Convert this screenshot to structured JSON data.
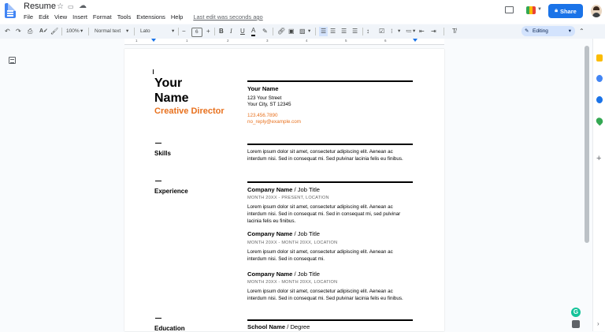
{
  "doc": {
    "title": "Resume",
    "last_edit": "Last edit was seconds ago",
    "share": "Share",
    "menus": [
      "File",
      "Edit",
      "View",
      "Insert",
      "Format",
      "Tools",
      "Extensions",
      "Help"
    ]
  },
  "toolbar": {
    "zoom": "100%",
    "style": "Normal text",
    "font": "Lato",
    "size": "6",
    "mode": "Editing"
  },
  "ruler": [
    "1",
    "1",
    "2",
    "3",
    "4",
    "5",
    "6"
  ],
  "resume": {
    "name_line1": "Your",
    "name_line2": "Name",
    "role": "Creative Director",
    "contact": {
      "name": "Your Name",
      "street": "123 Your Street",
      "city": "Your City, ST 12345",
      "phone": "123.456.7890",
      "email": "no_reply@example.com"
    },
    "skills_label": "Skills",
    "skills_text": [
      "Lorem ipsum dolor sit amet, consectetur adipiscing elit. Aenean ac",
      "interdum nisi. Sed in consequat mi. Sed pulvinar lacinia felis eu finibus."
    ],
    "experience_label": "Experience",
    "jobs": [
      {
        "company": "Company Name",
        "title": " / Job Title",
        "dates": "MONTH 20XX - PRESENT,  LOCATION",
        "lines": [
          "Lorem ipsum dolor sit amet, consectetur adipiscing elit. Aenean ac",
          "interdum nisi. Sed in consequat mi. Sed in consequat mi, sed pulvinar",
          "lacinia felis eu finibus."
        ]
      },
      {
        "company": "Company Name",
        "title": " / Job Title",
        "dates": "MONTH 20XX - MONTH 20XX,  LOCATION",
        "lines": [
          "Lorem ipsum dolor sit amet, consectetur adipiscing elit. Aenean ac",
          "interdum nisi. Sed in consequat mi."
        ]
      },
      {
        "company": "Company Name",
        "title": " / Job Title",
        "dates": "MONTH 20XX - MONTH 20XX,  LOCATION",
        "lines": [
          "Lorem ipsum dolor sit amet, consectetur adipiscing elit. Aenean ac",
          "interdum nisi. Sed in consequat mi. Sed pulvinar lacinia felis eu finibus."
        ]
      }
    ],
    "education_label": "Education",
    "school": "School Name",
    "degree": " / Degree"
  }
}
